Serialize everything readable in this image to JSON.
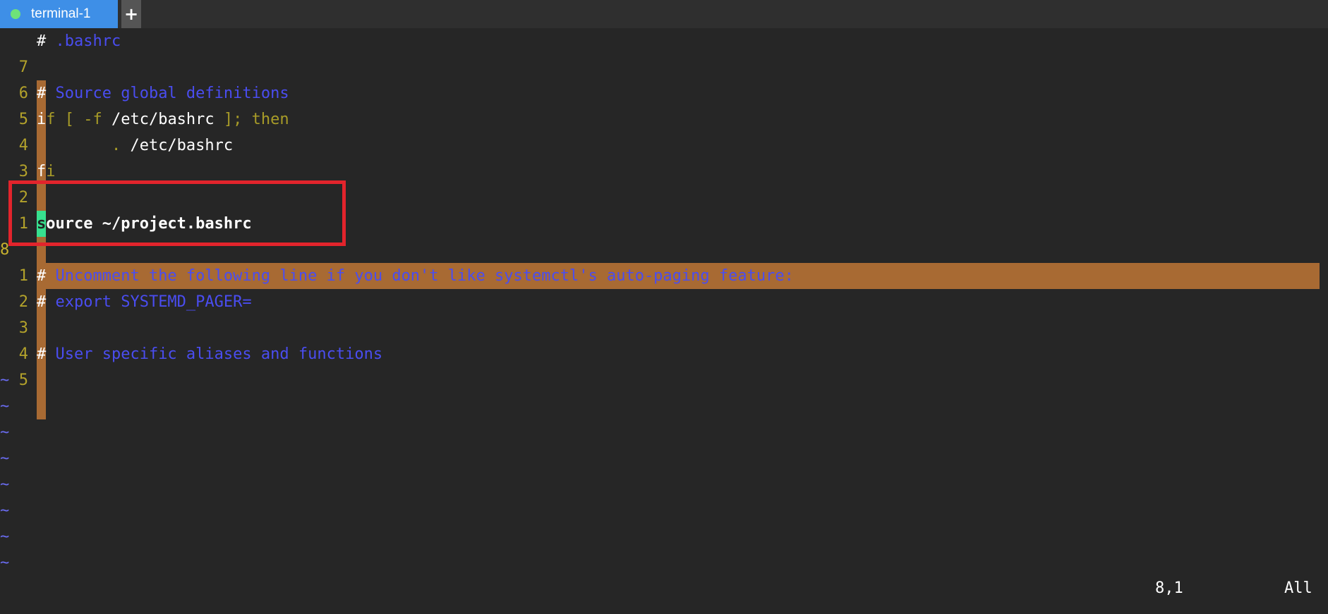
{
  "tab": {
    "label": "terminal-1",
    "status_color": "#6ee27a",
    "active_color": "#3e8fe7"
  },
  "add_tab": {
    "icon": "plus-icon",
    "label": "+"
  },
  "editor": {
    "lines": [
      {
        "num": "7",
        "hash": "#",
        "rest": " .bashrc",
        "style": "comment"
      },
      {
        "num": "6",
        "hash": "",
        "rest": "",
        "style": "blank"
      },
      {
        "num": "5",
        "hash": "#",
        "rest": " Source global definitions",
        "style": "comment"
      },
      {
        "num": "4",
        "first": "i",
        "rest": "f [ -f ",
        "path": "/etc/bashrc",
        "rest2": " ];",
        "kw": " then",
        "style": "if"
      },
      {
        "num": "3",
        "indent": "        . ",
        "path": "/etc/bashrc",
        "style": "source"
      },
      {
        "num": "2",
        "first": "f",
        "rest": "i",
        "style": "fi"
      },
      {
        "num": "1",
        "style": "blank"
      },
      {
        "num": "8",
        "cursor_char": "s",
        "rest": "ource ~/project.bashrc",
        "style": "current"
      },
      {
        "num": "1",
        "style": "blank"
      },
      {
        "num": "2",
        "hash": "#",
        "rest": " Uncomment the following line if you don't like systemctl's auto-paging feature:",
        "style": "comment"
      },
      {
        "num": "3",
        "hash": "#",
        "rest": " export SYSTEMD_PAGER=",
        "style": "comment"
      },
      {
        "num": "4",
        "style": "blank"
      },
      {
        "num": "5",
        "hash": "#",
        "rest": " User specific aliases and functions",
        "style": "comment"
      }
    ],
    "tilde": "~",
    "tilde_count": 8
  },
  "status": {
    "position": "8,1",
    "scroll": "All"
  },
  "colors": {
    "background": "#262626",
    "line_number": "#b3a22b",
    "comment": "#4a4df0",
    "keyword": "#a89c28",
    "current_line": "#a86a33",
    "cursor": "#37e08f",
    "annotation_box": "#e2242c"
  }
}
